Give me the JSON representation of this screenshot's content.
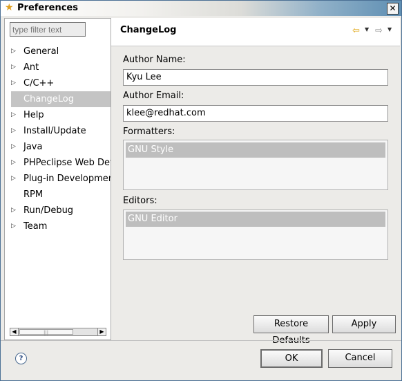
{
  "window": {
    "title": "Preferences",
    "close_glyph": "✕"
  },
  "filter": {
    "placeholder": "type filter text"
  },
  "tree": {
    "items": [
      {
        "label": "General",
        "expandable": true
      },
      {
        "label": "Ant",
        "expandable": true
      },
      {
        "label": "C/C++",
        "expandable": true
      },
      {
        "label": "ChangeLog",
        "expandable": false,
        "selected": true
      },
      {
        "label": "Help",
        "expandable": true
      },
      {
        "label": "Install/Update",
        "expandable": true
      },
      {
        "label": "Java",
        "expandable": true
      },
      {
        "label": "PHPeclipse Web Dev",
        "expandable": true
      },
      {
        "label": "Plug-in Development",
        "expandable": true
      },
      {
        "label": "RPM",
        "expandable": false
      },
      {
        "label": "Run/Debug",
        "expandable": true
      },
      {
        "label": "Team",
        "expandable": true
      }
    ]
  },
  "page": {
    "title": "ChangeLog",
    "author_name_label": "Author Name:",
    "author_name_value": "Kyu Lee",
    "author_email_label": "Author Email:",
    "author_email_value": "klee@redhat.com",
    "formatters_label": "Formatters:",
    "formatters": [
      "GNU Style"
    ],
    "editors_label": "Editors:",
    "editors": [
      "GNU Editor"
    ]
  },
  "buttons": {
    "restore_defaults": "Restore Defaults",
    "apply": "Apply",
    "ok": "OK",
    "cancel": "Cancel"
  },
  "icons": {
    "title": "star-icon",
    "back": "back-arrow-icon",
    "forward": "forward-arrow-icon",
    "help": "help-icon"
  },
  "colors": {
    "selection": "#c4c4c4",
    "back_arrow": "#e0a818"
  }
}
